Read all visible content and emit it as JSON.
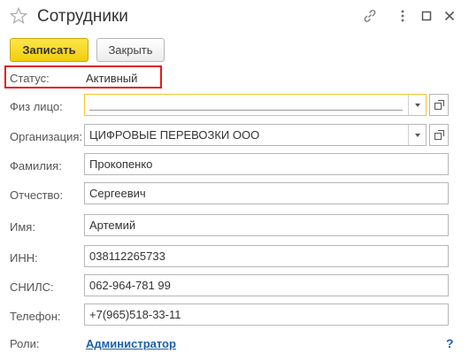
{
  "window": {
    "title": "Сотрудники",
    "icons": [
      "star-icon",
      "link-icon",
      "more-icon",
      "maximize-icon",
      "close-icon"
    ]
  },
  "toolbar": {
    "save_label": "Записать",
    "close_label": "Закрыть"
  },
  "form": {
    "status": {
      "label": "Статус:",
      "value": "Активный"
    },
    "person": {
      "label": "Физ лицо:",
      "value": ""
    },
    "organization": {
      "label": "Организация:",
      "value": "ЦИФРОВЫЕ ПЕРЕВОЗКИ ООО"
    },
    "last_name": {
      "label": "Фамилия:",
      "value": "Прокопенко"
    },
    "patronymic": {
      "label": "Отчество:",
      "value": "Сергеевич"
    },
    "first_name": {
      "label": "Имя:",
      "value": "Артемий"
    },
    "inn": {
      "label": "ИНН:",
      "value": "038112265733"
    },
    "snils": {
      "label": "СНИЛС:",
      "value": "062-964-781 99"
    },
    "phone": {
      "label": "Телефон:",
      "value": "+7(965)518-33-11"
    },
    "roles": {
      "label": "Роли:",
      "value": "Администратор"
    }
  },
  "help": {
    "label": "?"
  },
  "colors": {
    "accent": "#f0ce0c",
    "highlight": "#e21b1b",
    "link": "#1c5fa8",
    "focus": "#f0c528"
  }
}
